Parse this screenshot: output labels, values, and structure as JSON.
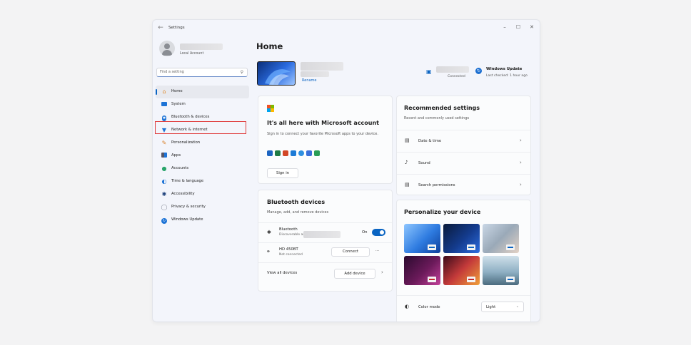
{
  "window": {
    "title": "Settings",
    "controls": {
      "minimize": "–",
      "maximize": "☐",
      "close": "✕"
    }
  },
  "profile": {
    "account_type": "Local Account"
  },
  "search": {
    "placeholder": "Find a setting"
  },
  "sidebar": {
    "items": [
      {
        "label": "Home",
        "icon": "home-icon",
        "active": true
      },
      {
        "label": "System",
        "icon": "monitor-icon"
      },
      {
        "label": "Bluetooth & devices",
        "icon": "bluetooth-icon"
      },
      {
        "label": "Network & internet",
        "icon": "wifi-icon",
        "highlighted": true
      },
      {
        "label": "Personalization",
        "icon": "brush-icon"
      },
      {
        "label": "Apps",
        "icon": "apps-icon"
      },
      {
        "label": "Accounts",
        "icon": "person-icon"
      },
      {
        "label": "Time & language",
        "icon": "globe-clock-icon"
      },
      {
        "label": "Accessibility",
        "icon": "accessibility-icon"
      },
      {
        "label": "Privacy & security",
        "icon": "shield-icon"
      },
      {
        "label": "Windows Update",
        "icon": "update-icon"
      }
    ]
  },
  "main": {
    "title": "Home",
    "device": {
      "rename_label": "Rename"
    },
    "network": {
      "status": "Connected"
    },
    "windows_update": {
      "title": "Windows Update",
      "subtitle": "Last checked: 1 hour ago"
    },
    "ms_account": {
      "title": "It's all here with Microsoft account",
      "description": "Sign in to connect your favorite Microsoft apps to your device.",
      "sign_in_label": "Sign in"
    },
    "bluetooth": {
      "title": "Bluetooth devices",
      "description": "Manage, add, and remove devices",
      "bluetooth_row": {
        "label": "Bluetooth",
        "sub": "Discoverable as",
        "state": "On"
      },
      "device_row": {
        "label": "HD 450BT",
        "sub": "Not connected",
        "connect_label": "Connect",
        "more": "···"
      },
      "view_all_label": "View all devices",
      "add_device_label": "Add device"
    },
    "recommended": {
      "title": "Recommended settings",
      "description": "Recent and commonly used settings",
      "items": [
        {
          "label": "Date & time",
          "icon": "calendar-clock-icon"
        },
        {
          "label": "Sound",
          "icon": "speaker-icon"
        },
        {
          "label": "Search permissions",
          "icon": "search-permissions-icon"
        }
      ]
    },
    "personalize": {
      "title": "Personalize your device",
      "color_mode_label": "Color mode",
      "color_mode_value": "Light"
    }
  },
  "colors": {
    "accent": "#0a64c2",
    "highlight_border": "#e03f3f"
  }
}
